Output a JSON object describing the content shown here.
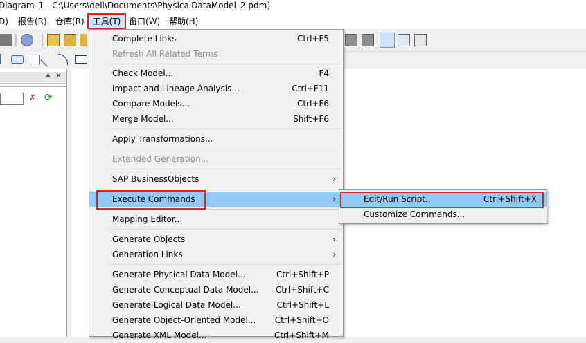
{
  "window": {
    "title": "Diagram_1 - C:\\Users\\dell\\Documents\\PhysicalDataModel_2.pdm]"
  },
  "menubar": [
    {
      "label": "D)"
    },
    {
      "label": "报告(R)"
    },
    {
      "label": "仓库(R)"
    },
    {
      "label": "工具(T)"
    },
    {
      "label": "窗口(W)"
    },
    {
      "label": "帮助(H)"
    }
  ],
  "tools_menu": {
    "complete_links": {
      "label": "Complete Links",
      "shortcut": "Ctrl+F5"
    },
    "refresh_terms": {
      "label": "Refresh All Related Terms"
    },
    "check_model": {
      "label": "Check Model...",
      "shortcut": "F4"
    },
    "impact_lineage": {
      "label": "Impact and Lineage Analysis...",
      "shortcut": "Ctrl+F11"
    },
    "compare_models": {
      "label": "Compare Models...",
      "shortcut": "Ctrl+F6"
    },
    "merge_model": {
      "label": "Merge Model...",
      "shortcut": "Shift+F6"
    },
    "apply_transformations": {
      "label": "Apply Transformations..."
    },
    "extended_generation": {
      "label": "Extended Generation..."
    },
    "sap_businessobjects": {
      "label": "SAP BusinessObjects",
      "arrow": "›"
    },
    "execute_commands": {
      "label": "Execute Commands",
      "arrow": "›"
    },
    "mapping_editor": {
      "label": "Mapping Editor..."
    },
    "generate_objects": {
      "label": "Generate Objects",
      "arrow": "›"
    },
    "generation_links": {
      "label": "Generation Links",
      "arrow": "›"
    },
    "gen_physical": {
      "label": "Generate Physical Data Model...",
      "shortcut": "Ctrl+Shift+P"
    },
    "gen_conceptual": {
      "label": "Generate Conceptual Data Model...",
      "shortcut": "Ctrl+Shift+C"
    },
    "gen_logical": {
      "label": "Generate Logical Data Model...",
      "shortcut": "Ctrl+Shift+L"
    },
    "gen_oo": {
      "label": "Generate Object-Oriented Model...",
      "shortcut": "Ctrl+Shift+O"
    },
    "gen_xml": {
      "label": "Generate XML Model...",
      "shortcut": "Ctrl+Shift+M"
    }
  },
  "execute_submenu": {
    "edit_run_script": {
      "label": "Edit/Run Script...",
      "shortcut": "Ctrl+Shift+X"
    },
    "customize_commands": {
      "label": "Customize Commands..."
    }
  },
  "colors": {
    "highlight": "#91c9f7",
    "annotation_red": "#d9261c",
    "menu_bg": "#f0f0f0"
  }
}
